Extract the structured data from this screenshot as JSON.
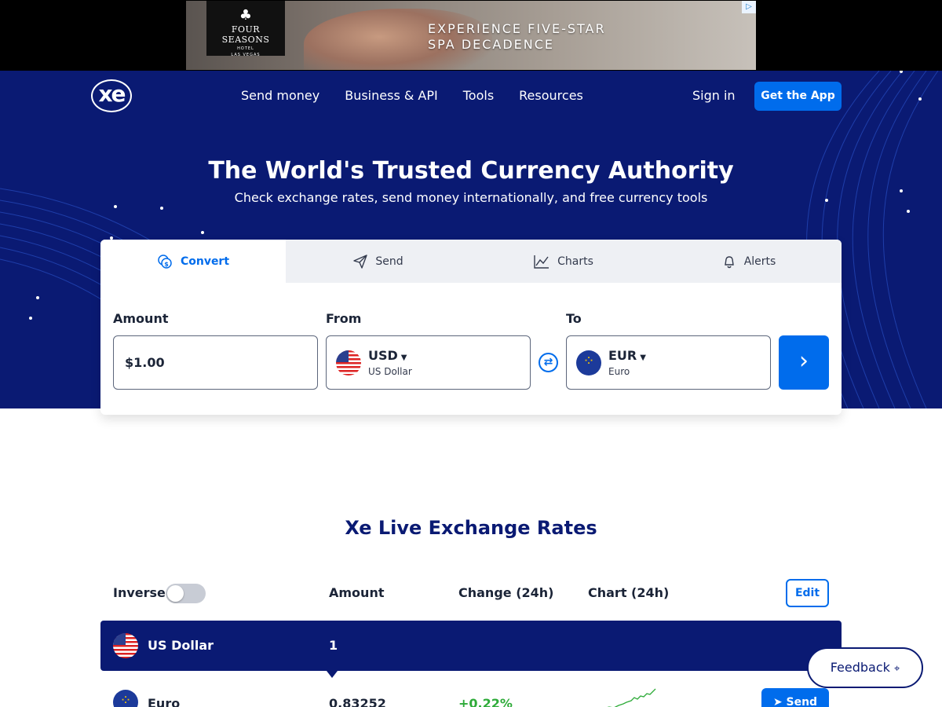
{
  "ad": {
    "brand": "FOUR SEASONS",
    "brand_sub": "HOTEL",
    "brand_city": "LAS VEGAS",
    "line1": "EXPERIENCE FIVE-STAR",
    "line2": "SPA DECADENCE"
  },
  "header": {
    "logo": "xe",
    "nav": [
      "Send money",
      "Business & API",
      "Tools",
      "Resources"
    ],
    "sign_in": "Sign in",
    "get_app": "Get the App"
  },
  "hero": {
    "title": "The World's Trusted Currency Authority",
    "subtitle": "Check exchange rates, send money internationally, and free currency tools"
  },
  "converter": {
    "tabs": [
      {
        "label": "Convert",
        "icon": "coins-icon",
        "active": true
      },
      {
        "label": "Send",
        "icon": "paper-plane-icon",
        "active": false
      },
      {
        "label": "Charts",
        "icon": "line-chart-icon",
        "active": false
      },
      {
        "label": "Alerts",
        "icon": "bell-icon",
        "active": false
      }
    ],
    "amount_label": "Amount",
    "amount_value": "$1.00",
    "from_label": "From",
    "from_code": "USD",
    "from_name": "US Dollar",
    "to_label": "To",
    "to_code": "EUR",
    "to_name": "Euro"
  },
  "rates": {
    "title": "Xe Live Exchange Rates",
    "inverse_label": "Inverse",
    "inverse_on": false,
    "col_amount": "Amount",
    "col_change": "Change (24h)",
    "col_chart": "Chart (24h)",
    "edit": "Edit",
    "base": {
      "name": "US Dollar",
      "amount": "1"
    },
    "rows": [
      {
        "name": "Euro",
        "amount": "0.83252",
        "change": "+0.22%",
        "send": "Send"
      }
    ]
  },
  "feedback": "Feedback",
  "colors": {
    "hero_bg": "#0a1a73",
    "accent": "#006cec",
    "positive": "#2eab39"
  }
}
